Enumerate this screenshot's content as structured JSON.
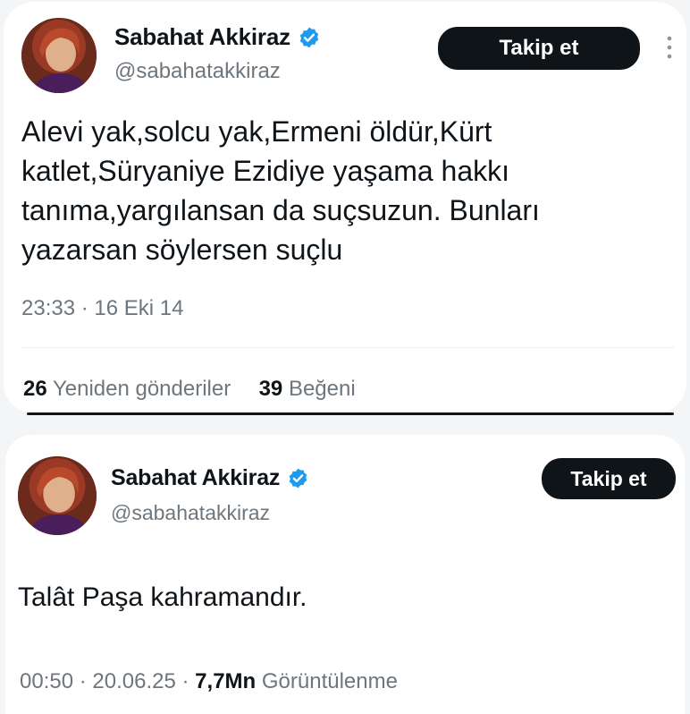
{
  "tweets": [
    {
      "name": "Sabahat Akkiraz",
      "handle": "@sabahatakkiraz",
      "follow_label": "Takip et",
      "more_icon": "⋮",
      "text": "Alevi yak,solcu yak,Ermeni öldür,Kürt katlet,Süryaniye Ezidiye yaşama hakkı tanıma,yargılansan da suçsuzun. Bunları yazarsan söylersen suçlu",
      "time": "23:33",
      "date": "16 Eki 14",
      "retweets_count": "26",
      "retweets_label": "Yeniden gönderiler",
      "likes_count": "39",
      "likes_label": "Beğeni"
    },
    {
      "name": "Sabahat Akkiraz",
      "handle": "@sabahatakkiraz",
      "follow_label": "Takip et",
      "text": "Talât Paşa kahramandır.",
      "time": "00:50",
      "date": "20.06.25",
      "views_count": "7,7Mn",
      "views_label": "Görüntülenme"
    }
  ],
  "separator": "·",
  "colors": {
    "verified": "#1d9bf0",
    "button": "#0f1419",
    "muted": "#6e767d"
  },
  "icons": {
    "verified": "verified-badge-icon",
    "more": "more-vertical-icon"
  }
}
